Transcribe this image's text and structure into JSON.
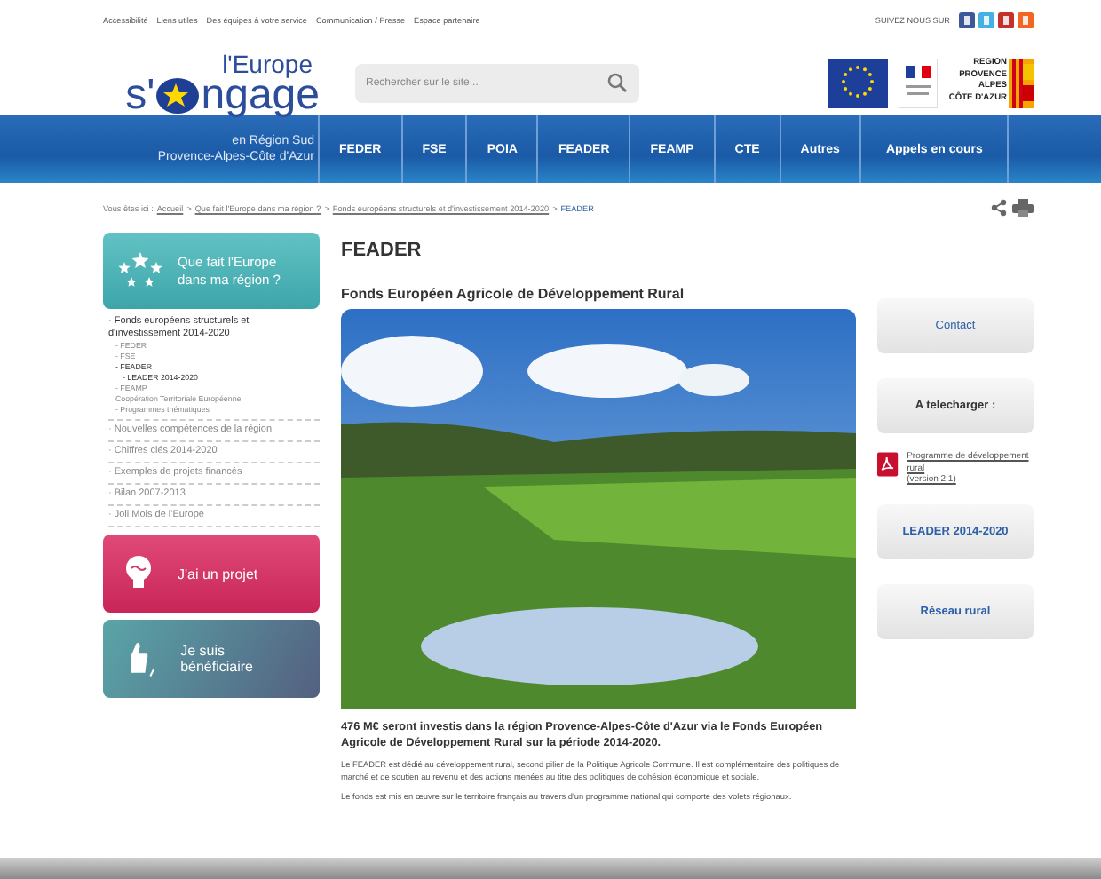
{
  "top_links": [
    "Accessibilité",
    "Liens utiles",
    "Des équipes à votre service",
    "Communication / Presse",
    "Espace partenaire"
  ],
  "follow_label": "SUIVEZ NOUS SUR",
  "logo": {
    "line1": "l'Europe",
    "prefix": "s'",
    "suffix": "ngage",
    "subtitle": "en Région Sud",
    "region": "Provence-Alpes-Côte d'Azur"
  },
  "search": {
    "placeholder": "Rechercher sur le site..."
  },
  "region_logo": [
    "REGION",
    "PROVENCE",
    "ALPES",
    "CÔTE D'AZUR"
  ],
  "nav": [
    "FEDER",
    "FSE",
    "POIA",
    "FEADER",
    "FEAMP",
    "CTE",
    "Autres",
    "Appels en cours"
  ],
  "breadcrumb": {
    "prefix": "Vous êtes ici :",
    "links": [
      "Accueil",
      "Que fait l'Europe dans ma région ?",
      "Fonds européens structurels et d'investissement 2014-2020"
    ],
    "separator": ">",
    "current": "FEADER"
  },
  "sidebar": {
    "heading": "Que fait l'Europe dans ma région ?",
    "items": [
      {
        "label": "· Fonds européens structurels et d'investissement 2014-2020",
        "selected": true,
        "children": [
          {
            "label": "- FEDER",
            "selected": false
          },
          {
            "label": "- FSE",
            "selected": false
          },
          {
            "label": "- FEADER",
            "selected": true,
            "children": [
              {
                "label": "- LEADER 2014-2020",
                "selected": true
              }
            ]
          },
          {
            "label": "- FEAMP",
            "selected": false
          },
          {
            "label": "Coopération Territoriale Européenne",
            "selected": false
          },
          {
            "label": "- Programmes thématiques",
            "selected": false
          }
        ]
      },
      {
        "label": "· Nouvelles compétences de la région",
        "selected": false
      },
      {
        "label": "· Chiffres clés 2014-2020",
        "selected": false
      },
      {
        "label": "· Exemples de projets financés",
        "selected": false
      },
      {
        "label": "· Bilan 2007-2013",
        "selected": false
      },
      {
        "label": "· Joli Mois de l'Europe",
        "selected": false
      }
    ],
    "buttons": [
      {
        "kind": "project",
        "label": "J'ai un projet"
      },
      {
        "kind": "beneficiary",
        "label": "Je suis bénéficiaire"
      }
    ]
  },
  "main": {
    "title": "FEADER",
    "subtitle": "Fonds Européen Agricole de Développement Rural",
    "lead": "476 M€ seront investis dans la région Provence-Alpes-Côte d'Azur via le Fonds Européen Agricole de Développement Rural sur la période 2014-2020.",
    "paragraphs": [
      "Le FEADER est dédié au développement rural, second pilier de la Politique Agricole Commune. Il est complémentaire des politiques de marché et de soutien au revenu et des actions menées au titre des politiques de cohésion économique et sociale.",
      "Le fonds est mis en œuvre sur le territoire français au travers d'un programme national qui comporte des volets régionaux."
    ]
  },
  "aside": {
    "contact": "Contact",
    "download_heading": "A telecharger :",
    "download": {
      "link": "Programme de développement rural",
      "note": "(version 2.1)"
    },
    "buttons": [
      "LEADER 2014-2020",
      "Réseau rural"
    ]
  }
}
